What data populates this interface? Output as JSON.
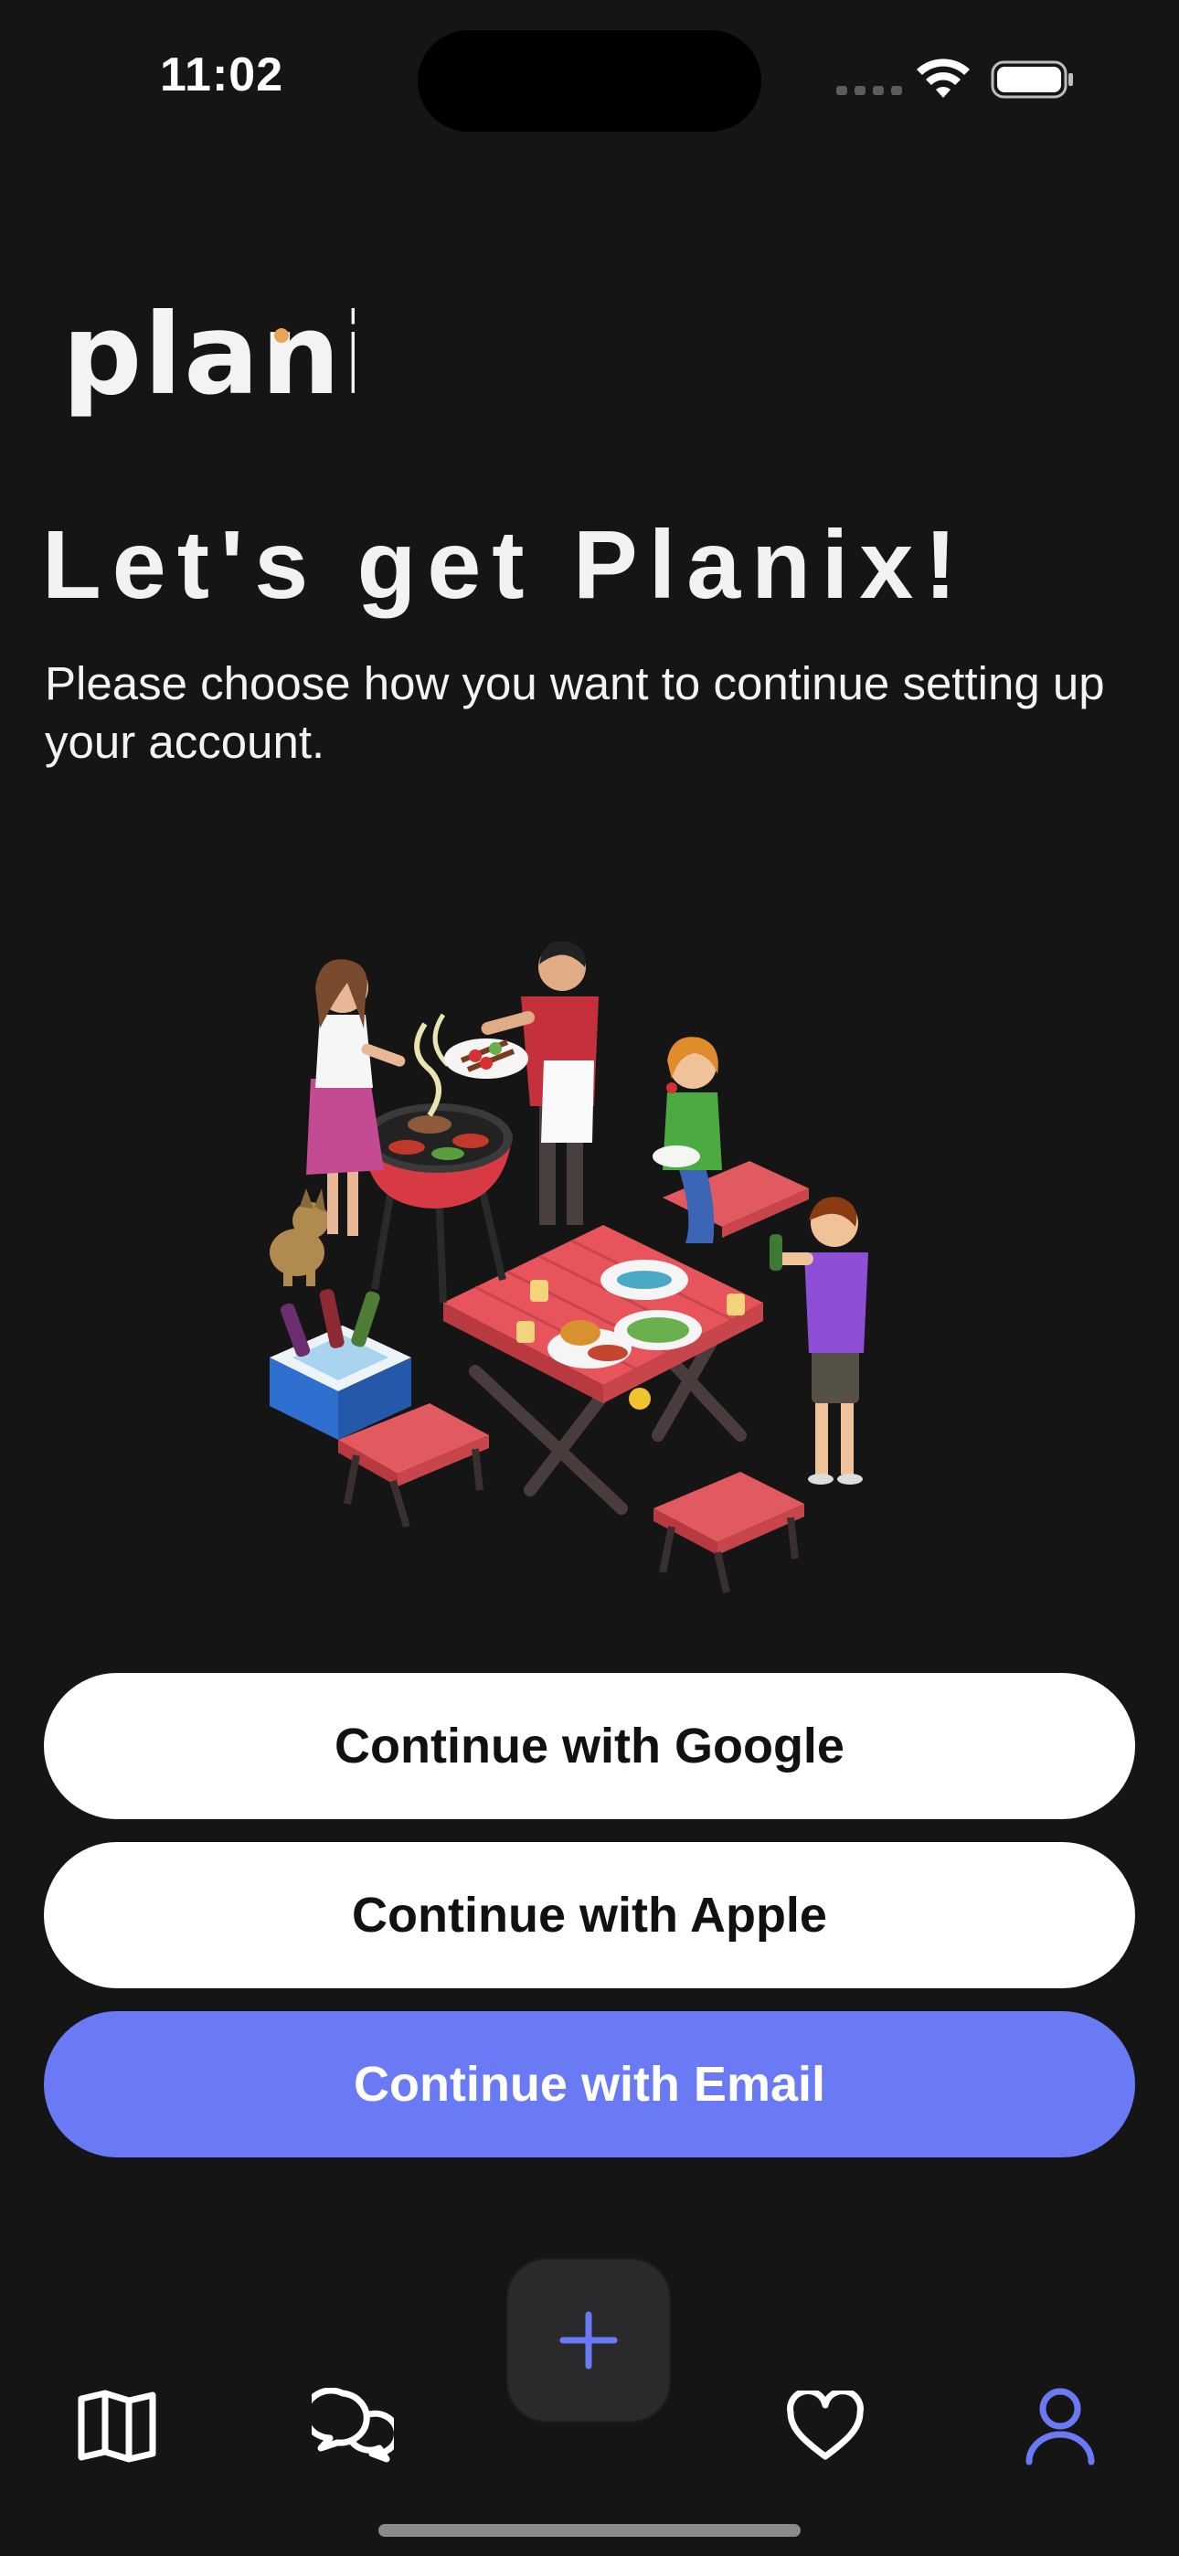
{
  "status_bar": {
    "time": "11:02"
  },
  "brand": {
    "logo_text": "planix",
    "accent_color": "#6a7af5",
    "logo_dot_color": "#e8a55a"
  },
  "onboarding": {
    "title": "Let's get Planix!",
    "subtitle": "Please choose how you want to continue setting up your account."
  },
  "buttons": {
    "google": "Continue with Google",
    "apple": "Continue with Apple",
    "email": "Continue with Email"
  },
  "tab_bar": {
    "items": [
      {
        "icon": "map-icon",
        "active": false
      },
      {
        "icon": "chat-icon",
        "active": false
      },
      {
        "icon": "plus-icon",
        "active": false
      },
      {
        "icon": "heart-icon",
        "active": false
      },
      {
        "icon": "profile-icon",
        "active": true
      }
    ]
  }
}
